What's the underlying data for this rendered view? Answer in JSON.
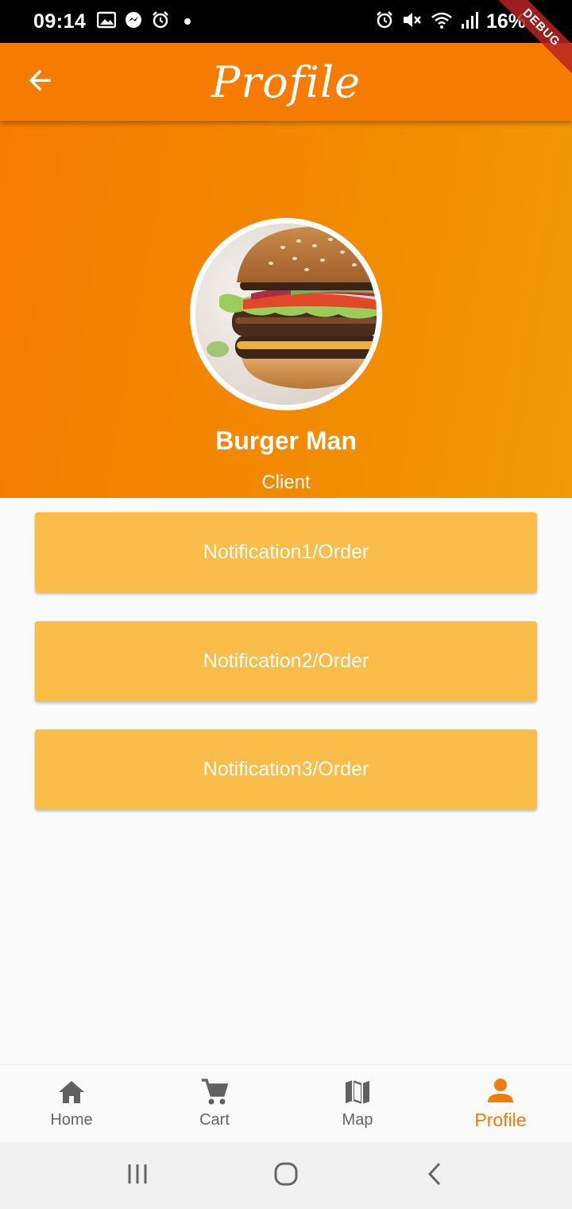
{
  "status_bar": {
    "time": "09:14",
    "battery": "16%"
  },
  "debug_banner": "DEBUG",
  "app_bar": {
    "title": "Profile",
    "back_icon": "arrow-back-icon"
  },
  "profile": {
    "name": "Burger Man",
    "role": "Client",
    "avatar": "burger-photo"
  },
  "notifications": [
    {
      "label": "Notification1/Order"
    },
    {
      "label": "Notification2/Order"
    },
    {
      "label": "Notification3/Order"
    }
  ],
  "bottom_nav": {
    "items": [
      {
        "label": "Home",
        "icon": "home-icon"
      },
      {
        "label": "Cart",
        "icon": "cart-icon"
      },
      {
        "label": "Map",
        "icon": "map-icon"
      },
      {
        "label": "Profile",
        "icon": "person-icon",
        "active": true
      }
    ]
  },
  "colors": {
    "primary": "#f57c00",
    "button": "#fbbd4a",
    "active_nav": "#ef7d0a",
    "inactive_nav": "#666666"
  }
}
